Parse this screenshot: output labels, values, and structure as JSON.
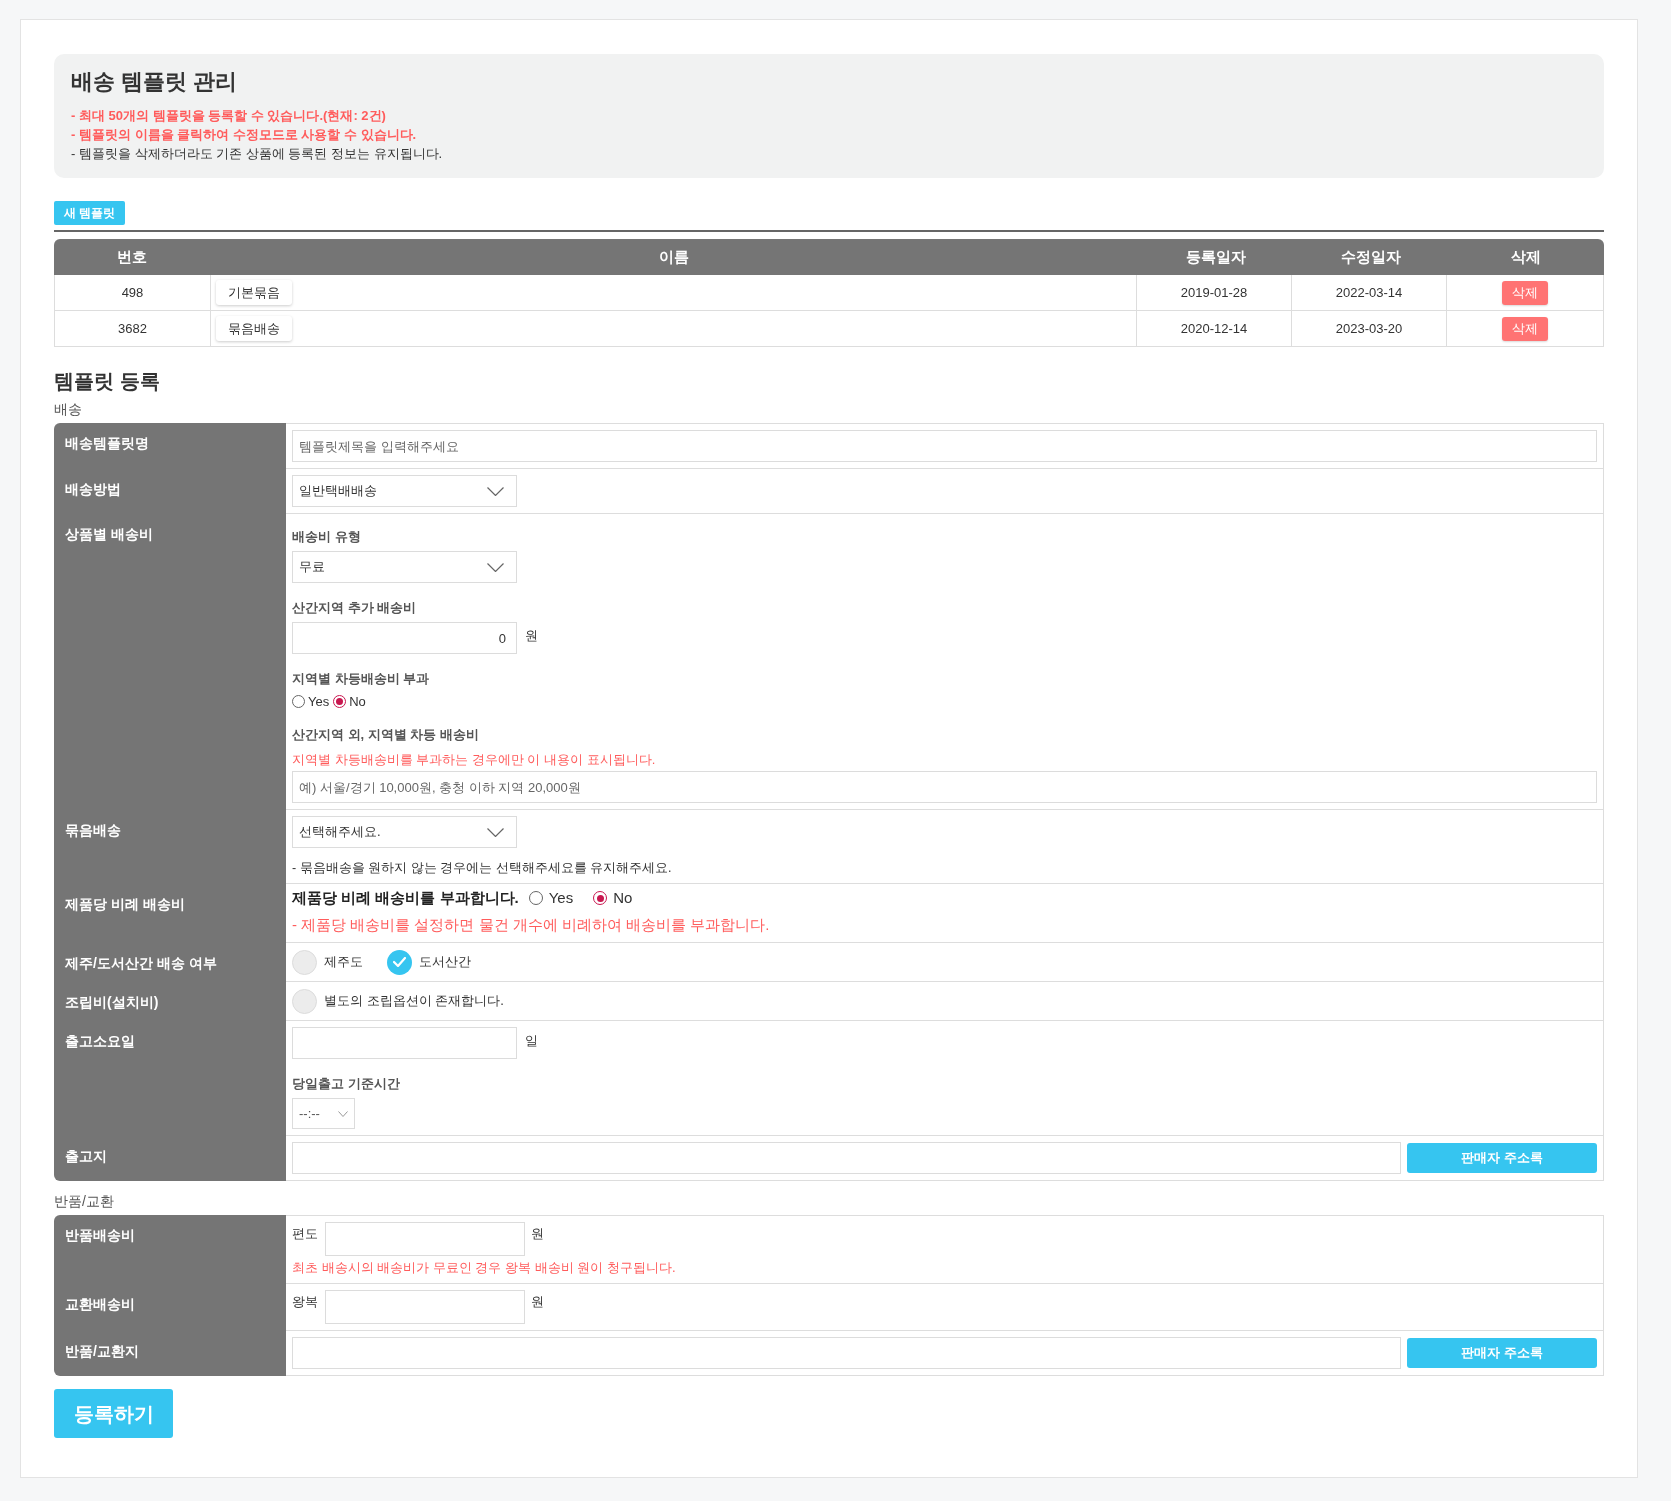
{
  "header": {
    "title": "배송 템플릿 관리",
    "notes": [
      {
        "kind": "warning",
        "text": "- 최대 50개의 템플릿을 등록할 수 있습니다.(현재: 2건)"
      },
      {
        "kind": "warning",
        "text": "- 템플릿의 이름을 클릭하여 수정모드로 사용할 수 있습니다."
      },
      {
        "kind": "info",
        "text": "- 템플릿을 삭제하더라도 기존 상품에 등록된 정보는 유지됩니다."
      }
    ]
  },
  "new_template_button": "새 템플릿",
  "template_table": {
    "columns": [
      "번호",
      "이름",
      "등록일자",
      "수정일자",
      "삭제"
    ],
    "rows": [
      {
        "number": "498",
        "name": "기본묶음",
        "registered": "2019-01-28",
        "modified": "2022-03-14",
        "action": "삭제"
      },
      {
        "number": "3682",
        "name": "묶음배송",
        "registered": "2020-12-14",
        "modified": "2023-03-20",
        "action": "삭제"
      }
    ]
  },
  "registration": {
    "title": "템플릿 등록",
    "sections": [
      {
        "title": "배송",
        "rows": [
          {
            "label": "배송템플릿명",
            "fields": [
              {
                "kind": "text",
                "placeholder": "템플릿제목을 입력해주세요"
              }
            ]
          },
          {
            "label": "배송방법",
            "fields": [
              {
                "kind": "select",
                "value": "일반택배배송"
              }
            ]
          },
          {
            "label": "상품별 배송비",
            "fields": [
              {
                "kind": "caption",
                "text": "배송비 유형"
              },
              {
                "kind": "select",
                "value": "무료"
              },
              {
                "kind": "caption",
                "text": "산간지역 추가 배송비"
              },
              {
                "kind": "amount",
                "value": "0",
                "unit": "원"
              },
              {
                "kind": "caption",
                "text": "지역별 차등배송비 부과"
              },
              {
                "kind": "radios",
                "options": [
                  {
                    "label": "Yes",
                    "selected": false
                  },
                  {
                    "label": "No",
                    "selected": true
                  }
                ]
              },
              {
                "kind": "caption",
                "text": "산간지역 외, 지역별 차등 배송비"
              },
              {
                "kind": "warning",
                "text": "지역별 차등배송비를 부과하는 경우에만 이 내용이 표시됩니다."
              },
              {
                "kind": "text",
                "placeholder": "예) 서울/경기 10,000원, 충청 이하 지역 20,000원"
              }
            ]
          },
          {
            "label": "묶음배송",
            "fields": [
              {
                "kind": "select",
                "value": "선택해주세요."
              },
              {
                "kind": "hint",
                "text": "- 묶음배송을 원하지 않는 경우에는 선택해주세요를 유지해주세요."
              }
            ]
          },
          {
            "label": "제품당 비례 배송비",
            "fields": [
              {
                "kind": "question",
                "prompt": "제품당 비례 배송비를 부과합니다.",
                "options": [
                  {
                    "label": "Yes",
                    "selected": false
                  },
                  {
                    "label": "No",
                    "selected": true
                  }
                ]
              },
              {
                "kind": "alert",
                "text": "- 제품당 배송비를 설정하면 물건 개수에 비례하여 배송비를 부과합니다."
              }
            ]
          },
          {
            "label": "제주/도서산간 배송 여부",
            "fields": [
              {
                "kind": "checks",
                "options": [
                  {
                    "label": "제주도",
                    "checked": false
                  },
                  {
                    "label": "도서산간",
                    "checked": true
                  }
                ]
              }
            ]
          },
          {
            "label": "조립비(설치비)",
            "fields": [
              {
                "kind": "checks",
                "options": [
                  {
                    "label": "별도의 조립옵션이 존재합니다.",
                    "checked": false
                  }
                ]
              }
            ]
          },
          {
            "label": "출고소요일",
            "fields": [
              {
                "kind": "amount",
                "unit": "일"
              },
              {
                "kind": "caption",
                "text": "당일출고 기준시간"
              },
              {
                "kind": "time",
                "value": "--:--"
              }
            ]
          },
          {
            "label": "출고지",
            "fields": [
              {
                "kind": "address",
                "button": "판매자 주소록"
              }
            ]
          }
        ]
      },
      {
        "title": "반품/교환",
        "rows": [
          {
            "label": "반품배송비",
            "fields": [
              {
                "kind": "prefixed",
                "prefix": "편도",
                "unit": "원"
              },
              {
                "kind": "warning",
                "text": "최초 배송시의 배송비가 무료인 경우 왕복 배송비 원이 청구됩니다."
              }
            ]
          },
          {
            "label": "교환배송비",
            "fields": [
              {
                "kind": "prefixed",
                "prefix": "왕복",
                "unit": "원"
              }
            ]
          },
          {
            "label": "반품/교환지",
            "fields": [
              {
                "kind": "address",
                "button": "판매자 주소록"
              }
            ]
          }
        ]
      }
    ]
  },
  "submit_button": "등록하기"
}
